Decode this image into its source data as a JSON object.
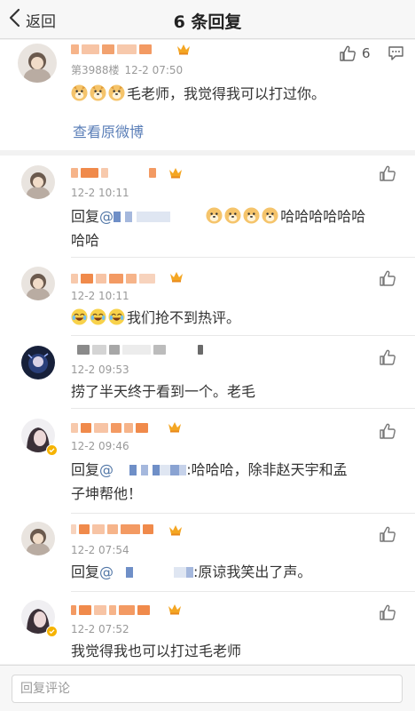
{
  "nav": {
    "back_label": "返回",
    "title": "6 条回复"
  },
  "root_comment": {
    "floor": "第3988楼",
    "time": "12-2 07:50",
    "text": "毛老师，我觉得我可以打过你。",
    "like_count": "6",
    "view_original": "查看原微博",
    "emoji_count": 3,
    "emoji": "doge-emoji"
  },
  "replies": [
    {
      "time": "12-2 10:11",
      "line1_prefix": "回复",
      "line1_text": "哈哈哈哈哈哈",
      "line2_text": "哈哈",
      "emoji": "doge-emoji",
      "emoji_count": 4
    },
    {
      "time": "12-2 10:11",
      "text": "我们抢不到热评。",
      "emoji": "laugh-cry-emoji",
      "emoji_count": 3
    },
    {
      "time": "12-2 09:53",
      "text": "捞了半天终于看到一个。老毛"
    },
    {
      "time": "12-2 09:46",
      "line1_prefix": "回复",
      "line1_text": ":哈哈哈，除非赵天宇和孟",
      "line2_text": "子坤帮他！"
    },
    {
      "time": "12-2 07:54",
      "prefix": "回复",
      "text": ":原谅我笑出了声。"
    },
    {
      "time": "12-2 07:52",
      "text": "我觉得我也可以打过毛老师"
    }
  ],
  "reply_input": {
    "placeholder": "回复评论"
  },
  "colors": {
    "link": "#5277a7",
    "meta": "#999999",
    "mask_orange": "#f08a4b",
    "mask_blue": "#6f8fc7",
    "crown": "#f4a623"
  },
  "icons": [
    "chevron-left-icon",
    "thumbs-up-icon",
    "more-comment-icon",
    "crown-badge-icon",
    "verified-badge-icon"
  ]
}
